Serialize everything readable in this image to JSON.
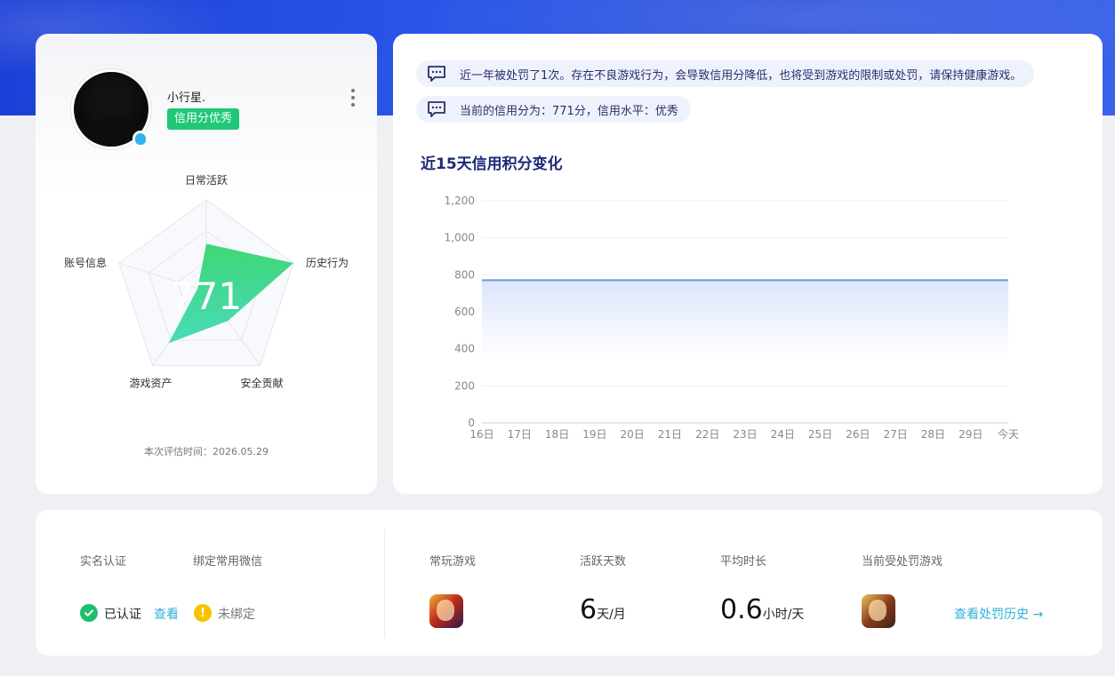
{
  "profile": {
    "nickname": "小行星.",
    "credit_badge": "信用分优秀",
    "score": "771",
    "eval_time": "本次评估时间：2026.05.29",
    "radar": {
      "axes": [
        "日常活跃",
        "历史行为",
        "安全贡献",
        "游戏资产",
        "账号信息"
      ],
      "values": [
        0.52,
        1.0,
        0.4,
        0.7,
        0.1
      ]
    }
  },
  "notices": [
    "近一年被处罚了1次。存在不良游戏行为，会导致信用分降低，也将受到游戏的限制或处罚，请保持健康游戏。",
    "当前的信用分为：771分，信用水平：优秀"
  ],
  "trend": {
    "title": "近15天信用积分变化"
  },
  "chart_data": {
    "type": "area",
    "title": "近15天信用积分变化",
    "categories": [
      "16日",
      "17日",
      "18日",
      "19日",
      "20日",
      "21日",
      "22日",
      "23日",
      "24日",
      "25日",
      "26日",
      "27日",
      "28日",
      "29日",
      "今天"
    ],
    "series": [
      {
        "values": [
          771,
          771,
          771,
          771,
          771,
          771,
          771,
          771,
          771,
          771,
          771,
          771,
          771,
          771,
          771
        ]
      }
    ],
    "ylim": [
      0,
      1200
    ],
    "yticks": [
      "0",
      "200",
      "400",
      "600",
      "800",
      "1,000",
      "1,200"
    ],
    "grid": true,
    "line_color": "#6a9ad8",
    "fill_color": "#dfe8fb"
  },
  "stats": {
    "real_name_label": "实名认证",
    "wechat_label": "绑定常用微信",
    "verified_text": "已认证",
    "view_link": "查看",
    "unbound_text": "未绑定",
    "fav_game_label": "常玩游戏",
    "active_days_label": "活跃天数",
    "active_days_value": "6",
    "active_days_unit": "天/月",
    "avg_time_label": "平均时长",
    "avg_time_value": "0.6",
    "avg_time_unit": "小时/天",
    "punished_game_label": "当前受处罚游戏",
    "history_link": "查看处罚历史 →"
  },
  "colors": {
    "accent": "#1fc877",
    "link": "#2db0d8",
    "title": "#1e2a78",
    "radar_fill_top": "#2fd46a",
    "radar_fill_bottom": "#3ad8b4"
  }
}
